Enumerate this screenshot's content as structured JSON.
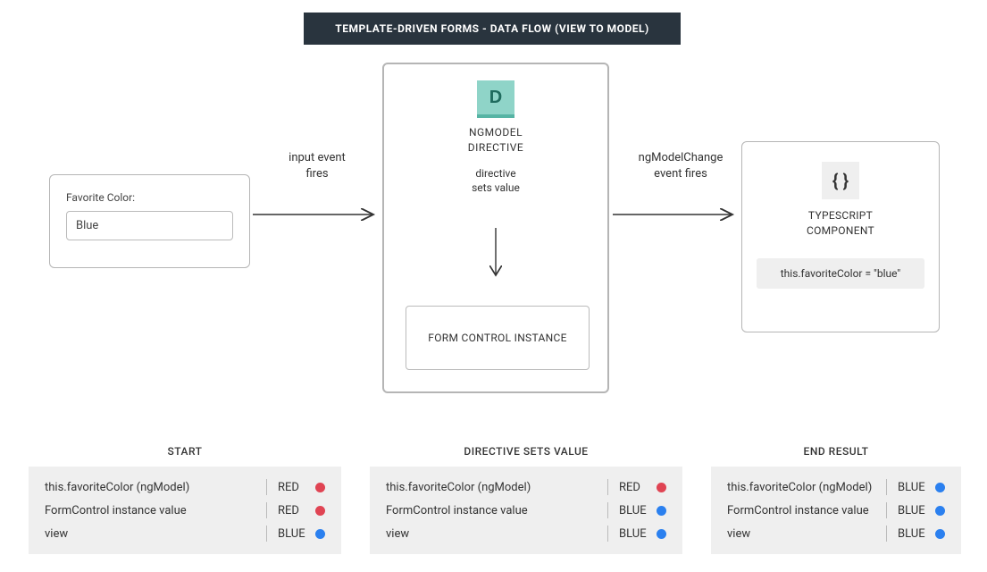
{
  "title": "TEMPLATE-DRIVEN FORMS - DATA FLOW (VIEW TO MODEL)",
  "view": {
    "label": "Favorite Color:",
    "value": "Blue"
  },
  "arrow1_label_line1": "input event",
  "arrow1_label_line2": "fires",
  "directive": {
    "icon_letter": "D",
    "title_line1": "NGMODEL",
    "title_line2": "DIRECTIVE",
    "sets_line1": "directive",
    "sets_line2": "sets value",
    "form_control": "FORM CONTROL INSTANCE"
  },
  "arrow2_label_line1": "ngModelChange",
  "arrow2_label_line2": "event fires",
  "component": {
    "braces": "{ }",
    "title_line1": "TYPESCRIPT",
    "title_line2": "COMPONENT",
    "code": "this.favoriteColor = \"blue\""
  },
  "states": [
    {
      "heading": "START",
      "rows": [
        {
          "label": "this.favoriteColor (ngModel)",
          "value": "RED",
          "color": "red"
        },
        {
          "label": "FormControl instance value",
          "value": "RED",
          "color": "red"
        },
        {
          "label": "view",
          "value": "BLUE",
          "color": "blue"
        }
      ]
    },
    {
      "heading": "DIRECTIVE SETS VALUE",
      "rows": [
        {
          "label": "this.favoriteColor (ngModel)",
          "value": "RED",
          "color": "red"
        },
        {
          "label": "FormControl instance value",
          "value": "BLUE",
          "color": "blue"
        },
        {
          "label": "view",
          "value": "BLUE",
          "color": "blue"
        }
      ]
    },
    {
      "heading": "END RESULT",
      "rows": [
        {
          "label": "this.favoriteColor (ngModel)",
          "value": "BLUE",
          "color": "blue"
        },
        {
          "label": "FormControl instance value",
          "value": "BLUE",
          "color": "blue"
        },
        {
          "label": "view",
          "value": "BLUE",
          "color": "blue"
        }
      ]
    }
  ]
}
